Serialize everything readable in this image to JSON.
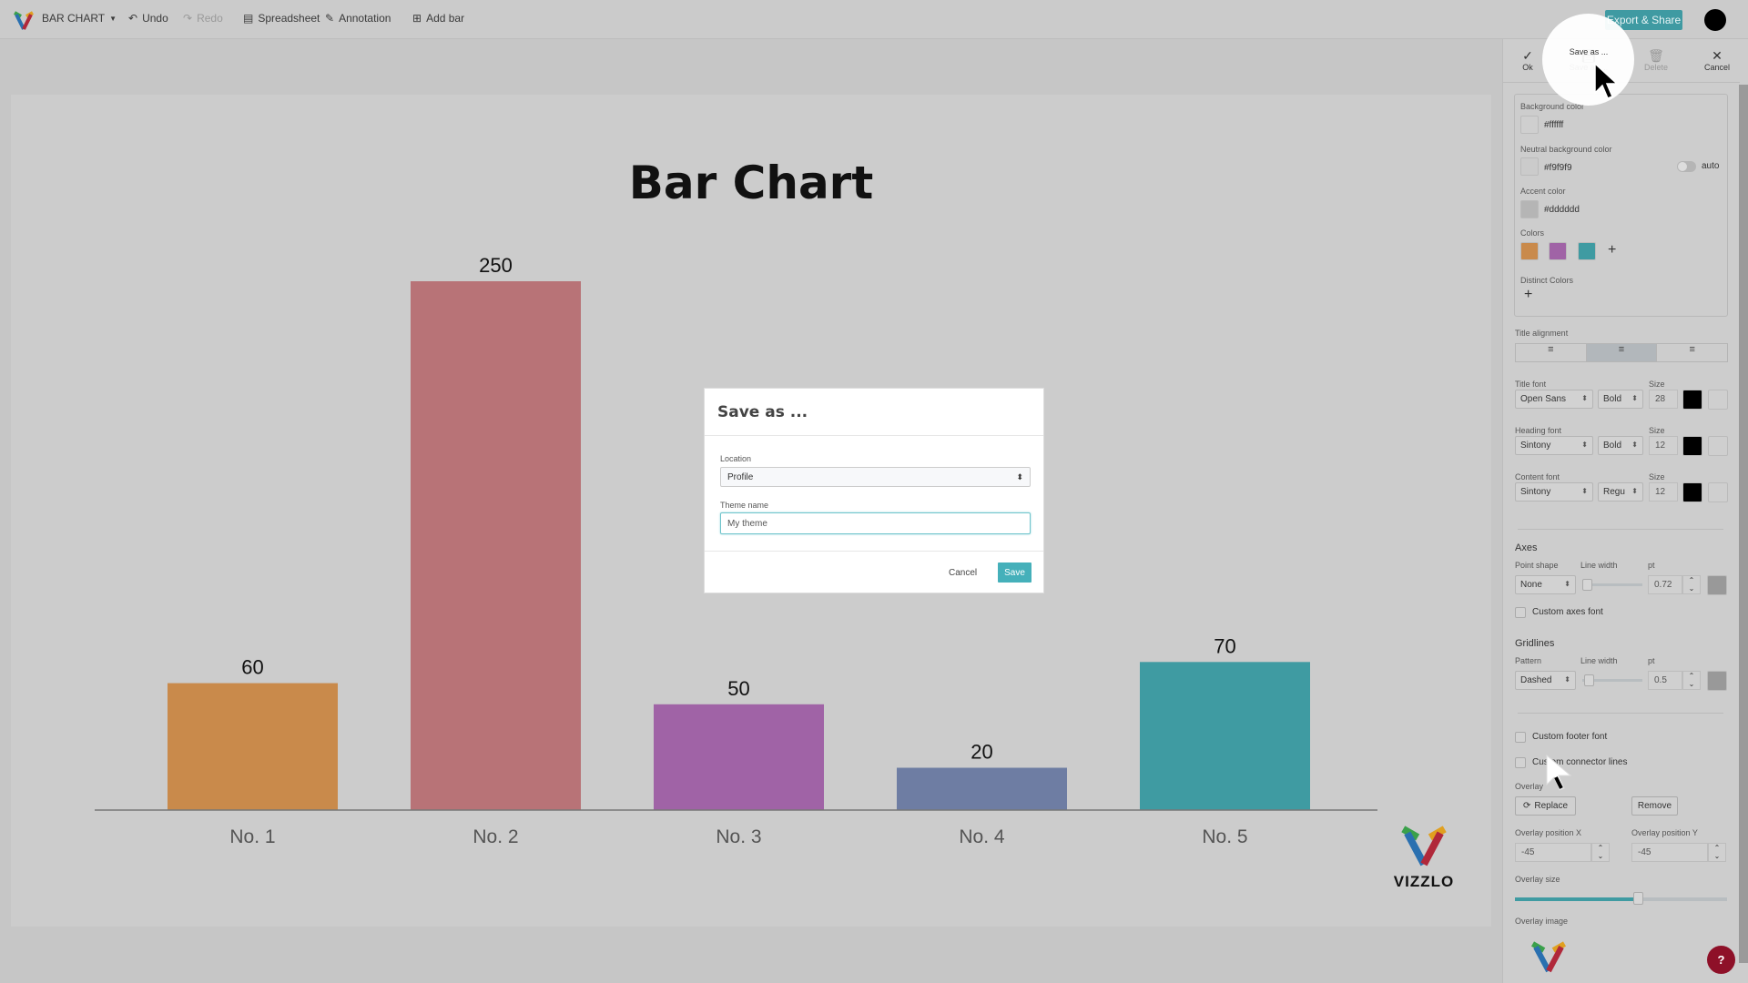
{
  "app": {
    "title": "BAR CHART",
    "undo": "Undo",
    "redo": "Redo",
    "spreadsheet": "Spreadsheet",
    "annotation": "Annotation",
    "add_bar": "Add bar",
    "export": "Export & Share"
  },
  "panel_toolbar": {
    "ok": "Ok",
    "save_as": "Save as ...",
    "delete": "Delete",
    "cancel": "Cancel"
  },
  "theme": {
    "background_color_label": "Background color",
    "background_color": "#ffffff",
    "neutral_label": "Neutral background color",
    "neutral_color": "#f9f9f9",
    "auto_label": "auto",
    "accent_label": "Accent color",
    "accent_color": "#dddddd",
    "colors_label": "Colors",
    "colors": [
      "#c98a4b",
      "#a063a6",
      "#3f9ba2"
    ],
    "distinct_label": "Distinct Colors",
    "title_alignment_label": "Title alignment",
    "title_alignment": "center",
    "size_label": "Size",
    "fonts": [
      {
        "label": "Title font",
        "family": "Open Sans",
        "weight": "Bold",
        "size": "28"
      },
      {
        "label": "Heading font",
        "family": "Sintony",
        "weight": "Bold",
        "size": "12"
      },
      {
        "label": "Content font",
        "family": "Sintony",
        "weight": "Regu",
        "size": "12"
      }
    ],
    "axes": {
      "heading": "Axes",
      "point_shape_label": "Point shape",
      "point_shape": "None",
      "line_width_label": "Line width",
      "pt_label": "pt",
      "pt": "0.72",
      "custom_font": "Custom axes font"
    },
    "gridlines": {
      "heading": "Gridlines",
      "pattern_label": "Pattern",
      "pattern": "Dashed",
      "line_width_label": "Line width",
      "pt_label": "pt",
      "pt": "0.5"
    },
    "custom_footer": "Custom footer font",
    "custom_connector": "Custom connector lines",
    "overlay": {
      "label": "Overlay",
      "replace": "Replace",
      "remove": "Remove",
      "pos_x_label": "Overlay position X",
      "pos_x": "-45",
      "pos_y_label": "Overlay position Y",
      "pos_y": "-45",
      "size_label": "Overlay size",
      "size_fraction": 0.58,
      "image_label": "Overlay image"
    }
  },
  "dialog": {
    "title": "Save as ...",
    "location_label": "Location",
    "location": "Profile",
    "theme_name_label": "Theme name",
    "theme_name": "My theme",
    "cancel": "Cancel",
    "save": "Save"
  },
  "logo": "VIZZLO",
  "help": "?",
  "chart_data": {
    "type": "bar",
    "title": "Bar Chart",
    "categories": [
      "No. 1",
      "No. 2",
      "No. 3",
      "No. 4",
      "No. 5"
    ],
    "values": [
      60,
      250,
      50,
      20,
      70
    ],
    "colors": [
      "#c98a4b",
      "#b87377",
      "#a063a6",
      "#6e7da3",
      "#3f9ba2"
    ],
    "ylim": [
      0,
      250
    ],
    "grid": false,
    "data_labels": true
  }
}
